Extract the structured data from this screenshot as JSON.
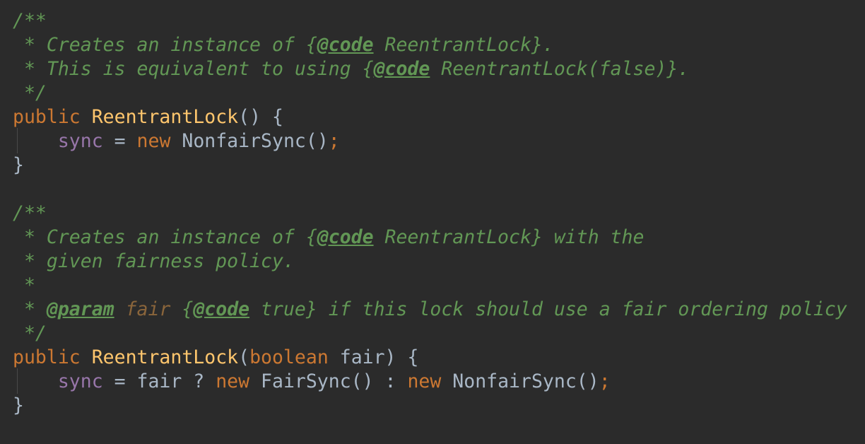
{
  "code": {
    "block1": {
      "c_open": "/**",
      "c_l1_star": " * ",
      "c_l1_a": "Creates an instance of {",
      "c_l1_tag": "@code",
      "c_l1_b": " ReentrantLock}.",
      "c_l2_star": " * ",
      "c_l2_a": "This is equivalent to using {",
      "c_l2_tag": "@code",
      "c_l2_b": " ReentrantLock(false)}.",
      "c_close": " */",
      "sig_kw": "public",
      "sig_sp": " ",
      "sig_fn": "ReentrantLock",
      "sig_rest": "() {",
      "body_indent": "    ",
      "body_field": "sync",
      "body_eq": " = ",
      "body_new": "new",
      "body_call": " NonfairSync()",
      "body_semi": ";",
      "close": "}"
    },
    "block2": {
      "c_open": "/**",
      "c_l1_star": " * ",
      "c_l1_a": "Creates an instance of {",
      "c_l1_tag": "@code",
      "c_l1_b": " ReentrantLock} with the",
      "c_l2": " * given fairness policy.",
      "c_l3": " *",
      "c_l4_star": " * ",
      "c_l4_tag1": "@param",
      "c_l4_sp": " ",
      "c_l4_param": "fair",
      "c_l4_a": " {",
      "c_l4_tag2": "@code",
      "c_l4_b": " true} if this lock should use a fair ordering policy",
      "c_close": " */",
      "sig_kw": "public",
      "sig_sp": " ",
      "sig_fn": "ReentrantLock",
      "sig_paren": "(",
      "sig_type": "boolean",
      "sig_rest": " fair) {",
      "body_indent": "    ",
      "body_field": "sync",
      "body_a": " = fair ? ",
      "body_new1": "new",
      "body_b": " FairSync() : ",
      "body_new2": "new",
      "body_c": " NonfairSync()",
      "body_semi": ";",
      "close": "}"
    }
  }
}
